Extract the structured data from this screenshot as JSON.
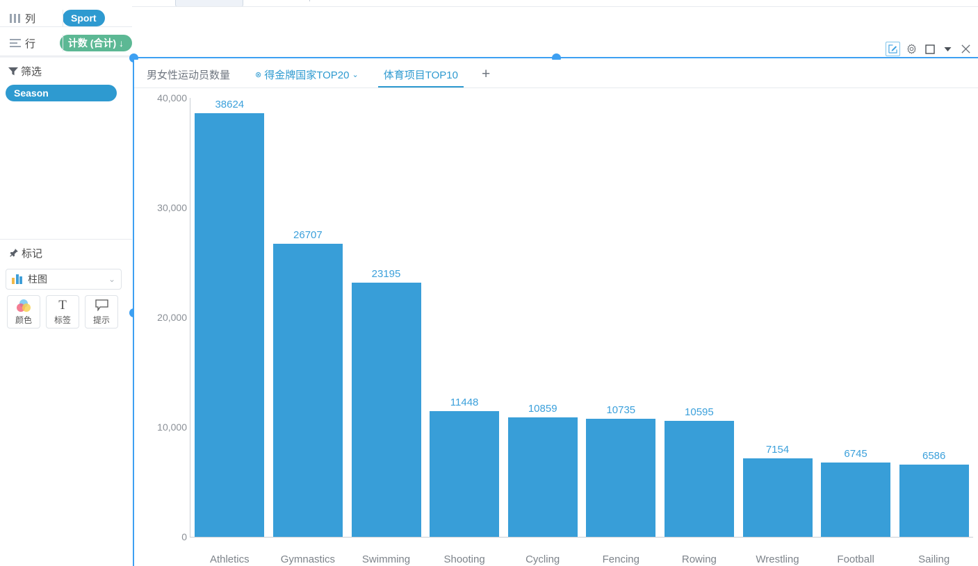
{
  "shelves": {
    "columns": {
      "label": "列",
      "icon": "columns-icon",
      "pill": "Sport"
    },
    "rows": {
      "label": "行",
      "icon": "rows-icon",
      "pill": "计数 (合计) ↓"
    }
  },
  "filters": {
    "header": "筛选",
    "icon": "filter-icon",
    "items": [
      {
        "label": "Season"
      }
    ]
  },
  "marks": {
    "header": "标记",
    "icon": "pin-icon",
    "mark_type": "柱图",
    "mark_type_icon": "bar-chart-icon",
    "caret": "⌄",
    "buttons": [
      {
        "label": "颜色",
        "icon": "color-circles-icon"
      },
      {
        "label": "标签",
        "icon": "text-T-icon"
      },
      {
        "label": "提示",
        "icon": "tooltip-bubble-icon"
      }
    ]
  },
  "toolbar": {
    "items": [
      {
        "name": "edit-icon",
        "glyph": "✎",
        "active": true
      },
      {
        "name": "gear-icon",
        "glyph": "⚙",
        "active": false
      },
      {
        "name": "square-icon",
        "glyph": "▢",
        "active": false
      },
      {
        "name": "chevron-down-icon",
        "glyph": "▾",
        "active": false
      },
      {
        "name": "close-icon",
        "glyph": "✕",
        "active": false
      }
    ]
  },
  "tabs": {
    "items": [
      {
        "label": "男女性运动员数量",
        "style": "plain",
        "close": false,
        "chevron": false
      },
      {
        "label": "得金牌国家TOP20",
        "style": "blue",
        "close": true,
        "chevron": true
      },
      {
        "label": "体育项目TOP10",
        "style": "active",
        "close": false,
        "chevron": false
      }
    ],
    "add_label": "+"
  },
  "colors": {
    "bar": "#389ed8",
    "label": "#3ba0db",
    "pill_blue": "#2e9ad0",
    "pill_green": "#5cb894",
    "splitter": "#3da0f2",
    "axis_text": "#8a8f96"
  },
  "chart_data": {
    "type": "bar",
    "title": "",
    "xlabel": "",
    "ylabel": "",
    "ylim": [
      0,
      40000
    ],
    "yticks": [
      "0",
      "10,000",
      "20,000",
      "30,000",
      "40,000"
    ],
    "ytick_values": [
      0,
      10000,
      20000,
      30000,
      40000
    ],
    "grid": false,
    "legend": "none",
    "categories": [
      "Athletics",
      "Gymnastics",
      "Swimming",
      "Shooting",
      "Cycling",
      "Fencing",
      "Rowing",
      "Wrestling",
      "Football",
      "Sailing"
    ],
    "values": [
      38624,
      26707,
      23195,
      11448,
      10859,
      10735,
      10595,
      7154,
      6745,
      6586
    ],
    "value_labels": [
      "38624",
      "26707",
      "23195",
      "11448",
      "10859",
      "10735",
      "10595",
      "7154",
      "6745",
      "6586"
    ]
  }
}
